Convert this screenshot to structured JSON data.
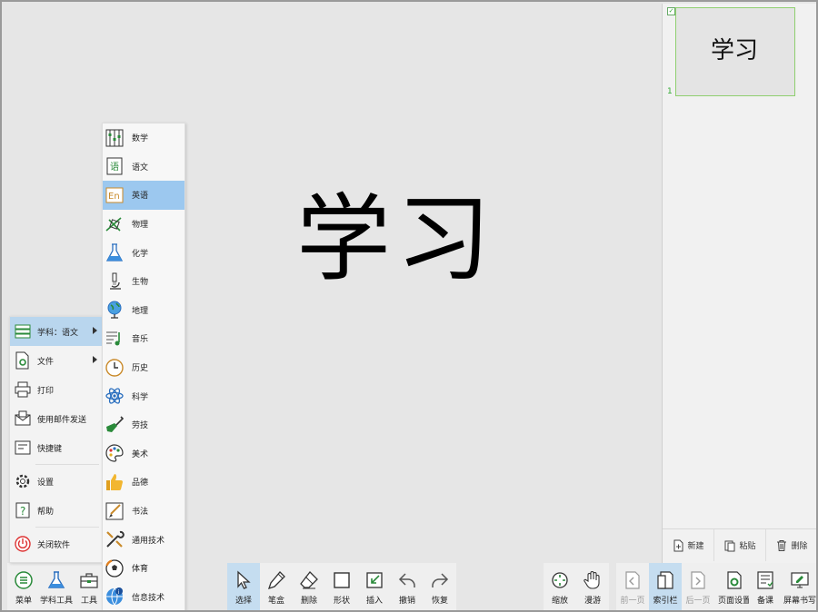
{
  "canvas": {
    "main_text": "学习"
  },
  "index_panel": {
    "thumbnail_text": "学习",
    "page_number": "1",
    "actions": [
      "新建",
      "粘贴",
      "删除"
    ]
  },
  "menu": {
    "items": [
      {
        "label": "学科：语文",
        "icon": "books-icon"
      },
      {
        "label": "文件",
        "icon": "file-gear-icon"
      },
      {
        "label": "打印",
        "icon": "printer-icon"
      },
      {
        "label": "使用邮件发送",
        "icon": "mail-icon"
      },
      {
        "label": "快捷键",
        "icon": "shortcut-icon"
      },
      {
        "label": "设置",
        "icon": "gear-icon"
      },
      {
        "label": "帮助",
        "icon": "help-icon"
      },
      {
        "label": "关闭软件",
        "icon": "power-icon"
      }
    ]
  },
  "submenu": {
    "items": [
      "数学",
      "语文",
      "英语",
      "物理",
      "化学",
      "生物",
      "地理",
      "音乐",
      "历史",
      "科学",
      "劳技",
      "美术",
      "品德",
      "书法",
      "通用技术",
      "体育",
      "信息技术"
    ],
    "selected": "英语"
  },
  "toolbar": {
    "left": [
      "菜单",
      "学科工具",
      "工具"
    ],
    "center": [
      "选择",
      "笔盒",
      "删除",
      "形状",
      "插入",
      "撤销",
      "恢复"
    ],
    "right_a": [
      "缩放",
      "漫游"
    ],
    "right_b": [
      "前一页",
      "索引栏",
      "后一页",
      "页面设置"
    ],
    "right_c": [
      "备课",
      "屏幕书写"
    ]
  },
  "colors": {
    "accent": "#9cc8ef",
    "active": "#c5ddf0",
    "thumb_border": "#8fcf6f"
  }
}
